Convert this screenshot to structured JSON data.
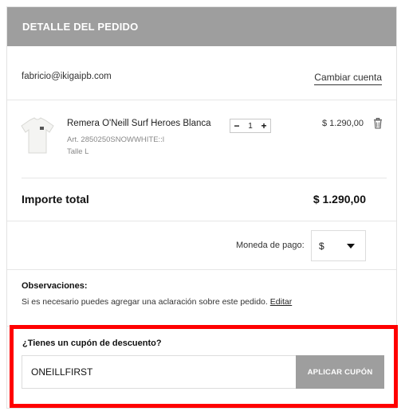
{
  "header": {
    "title": "DETALLE DEL PEDIDO"
  },
  "account": {
    "email": "fabricio@ikigaipb.com",
    "change_label": "Cambiar cuenta"
  },
  "product": {
    "name": "Remera O'Neill Surf Heroes Blanca",
    "article": "Art. 2850250SNOWWHITE::l",
    "size": "Talle L",
    "quantity": "1",
    "minus": "−",
    "plus": "+",
    "price": "$ 1.290,00",
    "thumbnail_icon": "white-tshirt-icon",
    "delete_icon": "trash-icon"
  },
  "total": {
    "label": "Importe total",
    "value": "$ 1.290,00"
  },
  "currency": {
    "label": "Moneda de pago:",
    "selected": "$"
  },
  "notes": {
    "title": "Observaciones:",
    "text": "Si es necesario puedes agregar una aclaración sobre este pedido.",
    "edit_label": "Editar"
  },
  "coupon": {
    "title": "¿Tienes un cupón de descuento?",
    "value": "ONEILLFIRST",
    "button_label": "APLICAR CUPÓN",
    "highlight_color": "#ff0000"
  },
  "colors": {
    "header_bg": "#9e9e9e",
    "button_bg": "#9e9e9e"
  }
}
